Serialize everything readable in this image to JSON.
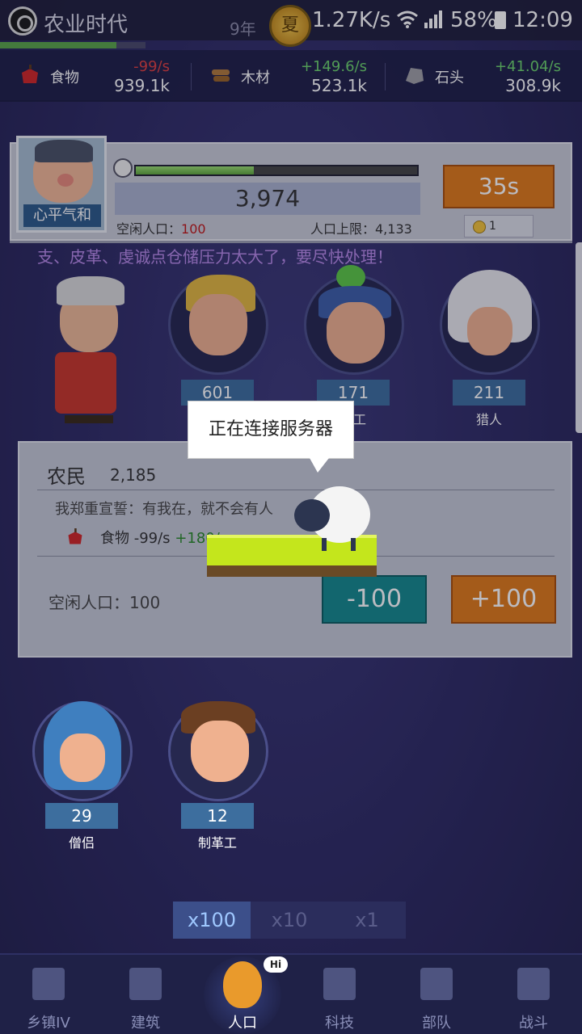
{
  "status": {
    "era_title": "农业时代",
    "year": "9年",
    "season": "夏",
    "net_speed": "1.27K/s",
    "battery": "58%",
    "time": "12:09"
  },
  "resources": [
    {
      "name": "食物",
      "rate": "-99/s",
      "amount": "939.1k",
      "icon": "apple-icon"
    },
    {
      "name": "木材",
      "rate": "+149.6/s",
      "amount": "523.1k",
      "icon": "wood-icon"
    },
    {
      "name": "石头",
      "rate": "+41.04/s",
      "amount": "308.9k",
      "icon": "stone-icon"
    }
  ],
  "leader": {
    "name": "心平气和",
    "population": "3,974",
    "population_progress": 0.42,
    "idle_label": "空闲人口：",
    "idle_value": "100",
    "cap_label": "人口上限：4,133",
    "timer_button": "35s",
    "coin_value": "1"
  },
  "warning": "支、皮革、虔诚点仓储压力太大了，要尽快处理！",
  "workers_top": [
    {
      "count": "",
      "role": ""
    },
    {
      "count": "601",
      "role": ""
    },
    {
      "count": "171",
      "role": "石工"
    },
    {
      "count": "211",
      "role": "猎人"
    }
  ],
  "farmer": {
    "title": "农民",
    "count": "2,185",
    "quote": "我郑重宣誓：有我在，就不会有人",
    "prod_label": "食物 -99/s",
    "prod_pos": "+180/s",
    "idle": "空闲人口：100",
    "minus": "-100",
    "plus": "+100"
  },
  "overlay": {
    "message": "正在连接服务器"
  },
  "workers_bottom": [
    {
      "count": "29",
      "role": "僧侣"
    },
    {
      "count": "12",
      "role": "制革工"
    }
  ],
  "multipliers": [
    "x100",
    "x10",
    "x1"
  ],
  "nav": [
    {
      "label": "乡镇IV",
      "icon": "castle-icon"
    },
    {
      "label": "建筑",
      "icon": "house-icon"
    },
    {
      "label": "人口",
      "icon": "mascot-icon"
    },
    {
      "label": "科技",
      "icon": "book-icon"
    },
    {
      "label": "部队",
      "icon": "banner-icon"
    },
    {
      "label": "战斗",
      "icon": "swords-icon"
    }
  ],
  "mascot_bubble": "Hi",
  "colors": {
    "accent_orange": "#e07a1a",
    "teal": "#168a8e",
    "warning_purple": "#b88ae8"
  }
}
